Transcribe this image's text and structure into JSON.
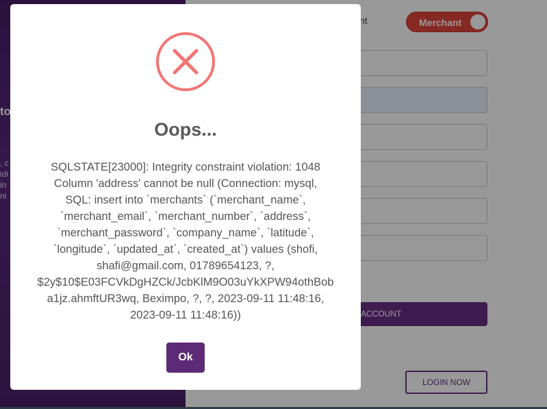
{
  "background": {
    "left_panel": {
      "heading": "to",
      "text_lines": [
        ", c",
        "idi",
        "in",
        "ni"
      ]
    },
    "form": {
      "toggle_side_label": "nt",
      "toggle_label": "Merchant",
      "create_button_label": "ACCOUNT",
      "login_button_label": "LOGIN NOW"
    }
  },
  "modal": {
    "icon": "error-x-icon",
    "title": "Oops...",
    "message_lines": [
      "SQLSTATE[23000]: Integrity constraint violation: 1048",
      "Column 'address' cannot be null (Connection: mysql,",
      "SQL: insert into `merchants` (`merchant_name`,",
      "`merchant_email`, `merchant_number`, `address`,",
      "`merchant_password`, `company_name`, `latitude`,",
      "`longitude`, `updated_at`, `created_at`) values (shofi,",
      "shafi@gmail.com, 01789654123, ?,",
      "$2y$10$E03FCVkDgHZCk/JcbKlM9O03uYkXPW94othBob",
      "a1jz.ahmftUR3wq, Beximpo, ?, ?, 2023-09-11 11:48:16,",
      "2023-09-11 11:48:16))"
    ],
    "ok_label": "Ok"
  },
  "colors": {
    "brand_purple": "#5c2a76",
    "error_red": "#f27474",
    "toggle_red": "#e0453b"
  }
}
